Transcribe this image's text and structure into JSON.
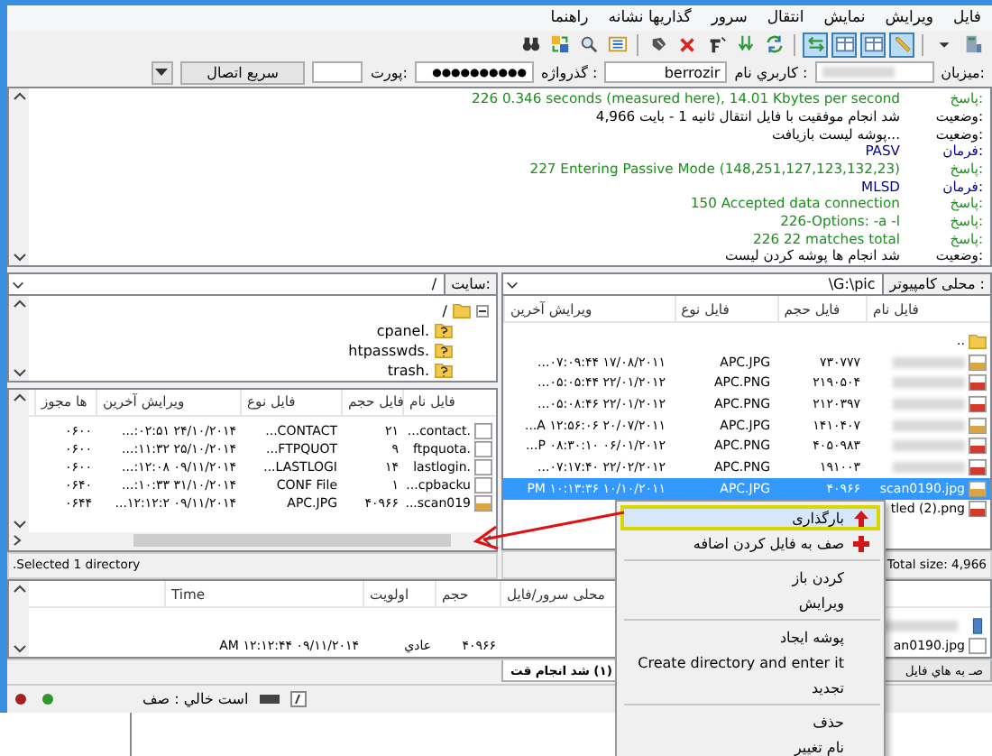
{
  "menu_bar": [
    "فایل",
    "ویرایش",
    "نمایش",
    "انتقال",
    "سرور",
    "نشانه گذاریها",
    "راهنما"
  ],
  "toolbar": [
    [
      {
        "kind": "server",
        "pressed": false
      },
      {
        "kind": "caret",
        "pressed": false
      }
    ],
    [
      {
        "kind": "pencil",
        "pressed": true
      },
      {
        "kind": "panes",
        "pressed": true
      },
      {
        "kind": "panes",
        "pressed": true
      },
      {
        "kind": "swap",
        "pressed": true
      }
    ],
    [
      {
        "kind": "refresh",
        "pressed": false
      },
      {
        "kind": "download",
        "pressed": false
      },
      {
        "kind": "reconnect",
        "pressed": false
      },
      {
        "kind": "cancel",
        "pressed": false
      },
      {
        "kind": "disconnect",
        "pressed": false
      }
    ],
    [
      {
        "kind": "list",
        "pressed": false
      },
      {
        "kind": "search",
        "pressed": false
      },
      {
        "kind": "sync",
        "pressed": false
      },
      {
        "kind": "binoculars",
        "pressed": false
      }
    ]
  ],
  "quickconnect": {
    "host_label": "میزبان:",
    "username_label": "نام کاربري :",
    "username": "berrozir",
    "password_label": "گذرواژه :",
    "password": "●●●●●●●●●●",
    "port_label": "پورت:",
    "connect_button": "اتصال سریع"
  },
  "log": [
    {
      "kind": "response",
      "label": "پاسخ:",
      "text": "226 0.346 seconds (measured here), 14.01 Kbytes per second"
    },
    {
      "kind": "status",
      "label": "وضعیت:",
      "text": "4,966 بایت - 1 ثانیه انتقال فایل با موفقیت انجام شد"
    },
    {
      "kind": "status",
      "label": "وضعیت:",
      "text": "بازیافت لیست پوشه..."
    },
    {
      "kind": "command",
      "label": "فرمان:",
      "text": "PASV"
    },
    {
      "kind": "response",
      "label": "پاسخ:",
      "text": "227 Entering Passive Mode (148,251,127,123,132,23)"
    },
    {
      "kind": "command",
      "label": "فرمان:",
      "text": "MLSD"
    },
    {
      "kind": "response",
      "label": "پاسخ:",
      "text": "150 Accepted data connection"
    },
    {
      "kind": "response",
      "label": "پاسخ:",
      "text": "226-Options: -a -l"
    },
    {
      "kind": "response",
      "label": "پاسخ:",
      "text": "226 22 matches total"
    },
    {
      "kind": "status",
      "label": "وضعیت:",
      "text": "لیست کردن پوشه ها انجام شد"
    }
  ],
  "local": {
    "label": "کامپیوتر محلی :",
    "path": "\\G:\\pic",
    "columns": [
      "نام فایل",
      "حجم فایل",
      "نوع فایل",
      "آخرین ویرایش"
    ],
    "rows": [
      {
        "kind": "folder",
        "name": "..",
        "selected": false
      },
      {
        "kind": "jpg",
        "size": "۷۳۰۷۷۷",
        "type": "APC.JPG",
        "modified": "...۰۷:۰۹:۴۴ ۱۷/۰۸/۲۰۱۱",
        "selected": false
      },
      {
        "kind": "png",
        "size": "۲۱۹۰۵۰۴",
        "type": "APC.PNG",
        "modified": "...۰۵:۰۵:۴۴ ۲۲/۰۱/۲۰۱۲",
        "selected": false
      },
      {
        "kind": "png",
        "size": "۲۱۲۰۳۹۷",
        "type": "APC.PNG",
        "modified": "...۰۵:۰۸:۴۶ ۲۲/۰۱/۲۰۱۲",
        "selected": false
      },
      {
        "kind": "jpg",
        "size": "۱۴۱۰۴۰۷",
        "type": "APC.JPG",
        "modified": "...A ۱۲:۵۶:۰۶ ۲۰/۰۷/۲۰۱۱",
        "selected": false
      },
      {
        "kind": "png",
        "size": "۴۰۵۰۹۸۳",
        "type": "APC.PNG",
        "modified": "...P ۰۸:۳۰:۱۰ ۰۶/۰۱/۲۰۱۲",
        "selected": false
      },
      {
        "kind": "png",
        "size": "۱۹۱۰۰۳",
        "type": "APC.PNG",
        "modified": "...۰۷:۱۷:۴۰ ۲۲/۰۲/۲۰۱۲",
        "selected": false
      },
      {
        "kind": "jpg",
        "name": "scan0190.jpg",
        "size": "۴۰۹۶۶",
        "type": "APC.JPG",
        "modified": "PM ۱۰:۱۳:۳۶ ۱۰/۱۰/۲۰۱۱",
        "selected": true
      },
      {
        "kind": "png",
        "name": "tled (2).png",
        "selected": false
      }
    ],
    "status": "Total size: 4,966"
  },
  "remote": {
    "label": "سایت:",
    "path": "/",
    "tree": [
      {
        "name": "/",
        "kind": "folder",
        "expanded": true,
        "children": [
          {
            "name": "cpanel.",
            "kind": "unknown-folder"
          },
          {
            "name": "htpasswds.",
            "kind": "unknown-folder"
          },
          {
            "name": "trash.",
            "kind": "unknown-folder"
          }
        ]
      }
    ],
    "columns": [
      "نام فایل",
      "حجم فایل",
      "نوع فایل",
      "آخرین ویرایش",
      "مجوز ها"
    ],
    "rows": [
      {
        "kind": "file",
        "name": "...contact.",
        "size": "۲۱",
        "type": "...CONTACT",
        "modified": "...:۰۲:۵۱ ۲۴/۱۰/۲۰۱۴",
        "permissions": "۰۶۰۰"
      },
      {
        "kind": "file",
        "name": "ftpquota.",
        "size": "۹",
        "type": "...FTPQUOT",
        "modified": "...:۱۱:۳۲ ۲۵/۱۰/۲۰۱۴",
        "permissions": "۰۶۰۰"
      },
      {
        "kind": "file",
        "name": "lastlogin.",
        "size": "۱۴",
        "type": "...LASTLOGI",
        "modified": "...:۱۲:۰۸ ۰۹/۱۱/۲۰۱۴",
        "permissions": "۰۶۰۰"
      },
      {
        "kind": "file",
        "name": "...cpbacku",
        "size": "۱",
        "type": "CONF File",
        "modified": "...:۱۰:۳۳ ۳۱/۱۰/۲۰۱۴",
        "permissions": "۰۶۴۰"
      },
      {
        "kind": "jpg",
        "name": "...scan019",
        "size": "۴۰۹۶۶",
        "type": "APC.JPG",
        "modified": "...۱۲:۱۲:۲ ۰۹/۱۱/۲۰۱۴",
        "permissions": "۰۶۴۴"
      }
    ],
    "status": ".Selected 1 directory"
  },
  "queue": {
    "columns": [
      "سرور/فایل محلی",
      "حجم",
      "اولویت",
      "Time"
    ],
    "rows": [
      {
        "kind": "server"
      },
      {
        "kind": "file",
        "name": "an0190.jpg",
        "size": "۴۰۹۶۶",
        "priority": "عادي",
        "time": "AM ۱۲:۱۲:۴۴ ۰۹/۱۱/۲۰۱۴"
      }
    ]
  },
  "tabs": [
    {
      "label": "فایل هاي به صـ",
      "selected": false
    },
    {
      "label": "قت انجام شد (۱)",
      "selected": true
    }
  ],
  "status_bar": {
    "queue": "صف : خالي است"
  },
  "context_menu": [
    {
      "kind": "upload",
      "label": "بارگذاری",
      "selected": true
    },
    {
      "kind": "add",
      "label": "اضافه کردن فایل به صف",
      "selected": false
    },
    {
      "kind": "separator"
    },
    {
      "kind": "plain",
      "label": "باز کردن",
      "selected": false
    },
    {
      "kind": "plain",
      "label": "ویرایش",
      "selected": false
    },
    {
      "kind": "separator"
    },
    {
      "kind": "plain",
      "label": "ایجاد پوشه",
      "selected": false
    },
    {
      "kind": "plain",
      "label": "Create directory and enter it",
      "selected": false
    },
    {
      "kind": "plain",
      "label": "تجدید",
      "selected": false
    },
    {
      "kind": "separator"
    },
    {
      "kind": "plain",
      "label": "حذف",
      "selected": false
    },
    {
      "kind": "plain",
      "label": "تغییر نام",
      "selected": false
    }
  ]
}
